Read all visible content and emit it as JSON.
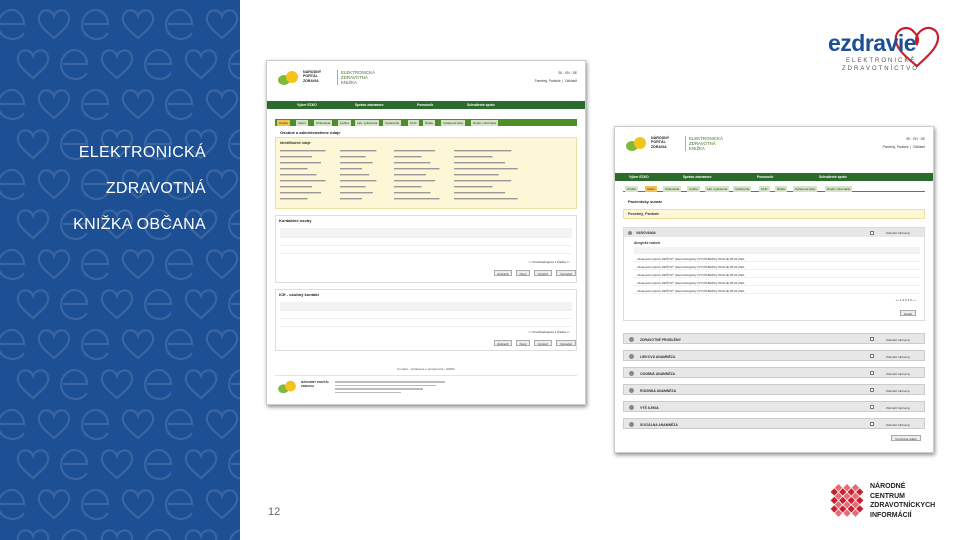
{
  "slide": {
    "title_lines": [
      "ELEKTRONICKÁ",
      "ZDRAVOTNÁ",
      "KNIŽKA OBČANA"
    ],
    "page_number": "12",
    "colors": {
      "left_panel": "#1d4f94",
      "logo_red": "#c8202f",
      "portal_green": "#2b6b2b"
    }
  },
  "logo_ezdravie": {
    "name": "ezdravie",
    "subtitle_lines": [
      "ELEKTRONICKÉ",
      "ZDRAVOTNÍCTVO"
    ]
  },
  "logo_nczi": {
    "lines": [
      "NÁRODNÉ",
      "CENTRUM",
      "ZDRAVOTNÍCKYCH",
      "INFORMÁCIÍ"
    ]
  },
  "screen1": {
    "portal_name": "NÁRODNÝ PORTÁL ZDRAVIA",
    "app_name": "ELEKTRONICKÁ ZDRAVOTNÁ KNIŽKA",
    "menu": [
      "Výber EZKO",
      "Správa záznamov",
      "Pomocník",
      "Schválenie správ"
    ],
    "tabs": [
      "Osoba",
      "Súhrn",
      "Očkovania",
      "Liečba",
      "Lab. vyšetrenia",
      "Vyšetrenia",
      "OUP",
      "Ďalšie",
      "Vyšetrené lieky",
      "Doplň. informácie"
    ],
    "section_title": "Osobné a administratívne údaje",
    "identification": "Identifikačné údaje",
    "pager": "<< Predchádzajúca  1  Ďalšia >>",
    "section2": "Kontaktné osoby",
    "section3": "ICE - osobný kontakt",
    "buttons": [
      "Zobraziť",
      "Nový",
      "Upraviť",
      "Vymazať"
    ],
    "footer_link": "Kontakt - vyhlásenie o prístupnosti - GDPR"
  },
  "screen2": {
    "portal_name": "NÁRODNÝ PORTÁL ZDRAVIA",
    "app_name": "ELEKTRONICKÁ ZDRAVOTNÁ KNIŽKA",
    "menu": [
      "Výber EZKO",
      "Správa záznamov",
      "Pomocník",
      "Schválenie správ"
    ],
    "tabs": [
      "Osoba",
      "Súhrn",
      "Očkovania",
      "Liečba",
      "Lab. vyšetrenia",
      "Vyšetrenia",
      "OUP",
      "Ďalšie",
      "Vyšetrené lieky",
      "Doplň. informácie"
    ],
    "section_title": "Pacientsky sumár",
    "patient_name": "Ponebný, Panbole",
    "varovania": "VAROVANIA",
    "alergie": "Alergické reakcie",
    "alergie_rows": [
      "Intoleranciu liekov  DEŠTNÝ (Dermatologický (SYNTHEMIA) OKOLIE  05.04.2021",
      "Intoleranciu liekov  DEŠTNÝ (Dermatologický (SYNTHEMIA) OKOLIE  05.04.2021",
      "Intoleranciu liekov  DEŠTNÝ (Dermatologický (SYNTHEMIA) OKOLIE  05.04.2021",
      "Intoleranciu liekov  DEŠTNÝ (Dermatologický (SYNTHEMIA) OKOLIE  05.04.2021",
      "Intoleranciu liekov  DEŠTNÝ (Dermatologický (SYNTHEMIA) OKOLIE  05.04.2021"
    ],
    "sections": [
      "ZDRAVOTNÉ PROBLÉMY",
      "LIEKOVÁ ANAMNÉZA",
      "OSOBNÁ ANAMNÉZA",
      "RODINNÁ ANAMNÉZA",
      "VÝŠ ILENIA",
      "SOCIÁLNA ANAMNÉZA"
    ],
    "show_label": "Zobraziť záznamy",
    "detail_button": "Detail",
    "bottom_button": "Kontrolné údaje"
  }
}
